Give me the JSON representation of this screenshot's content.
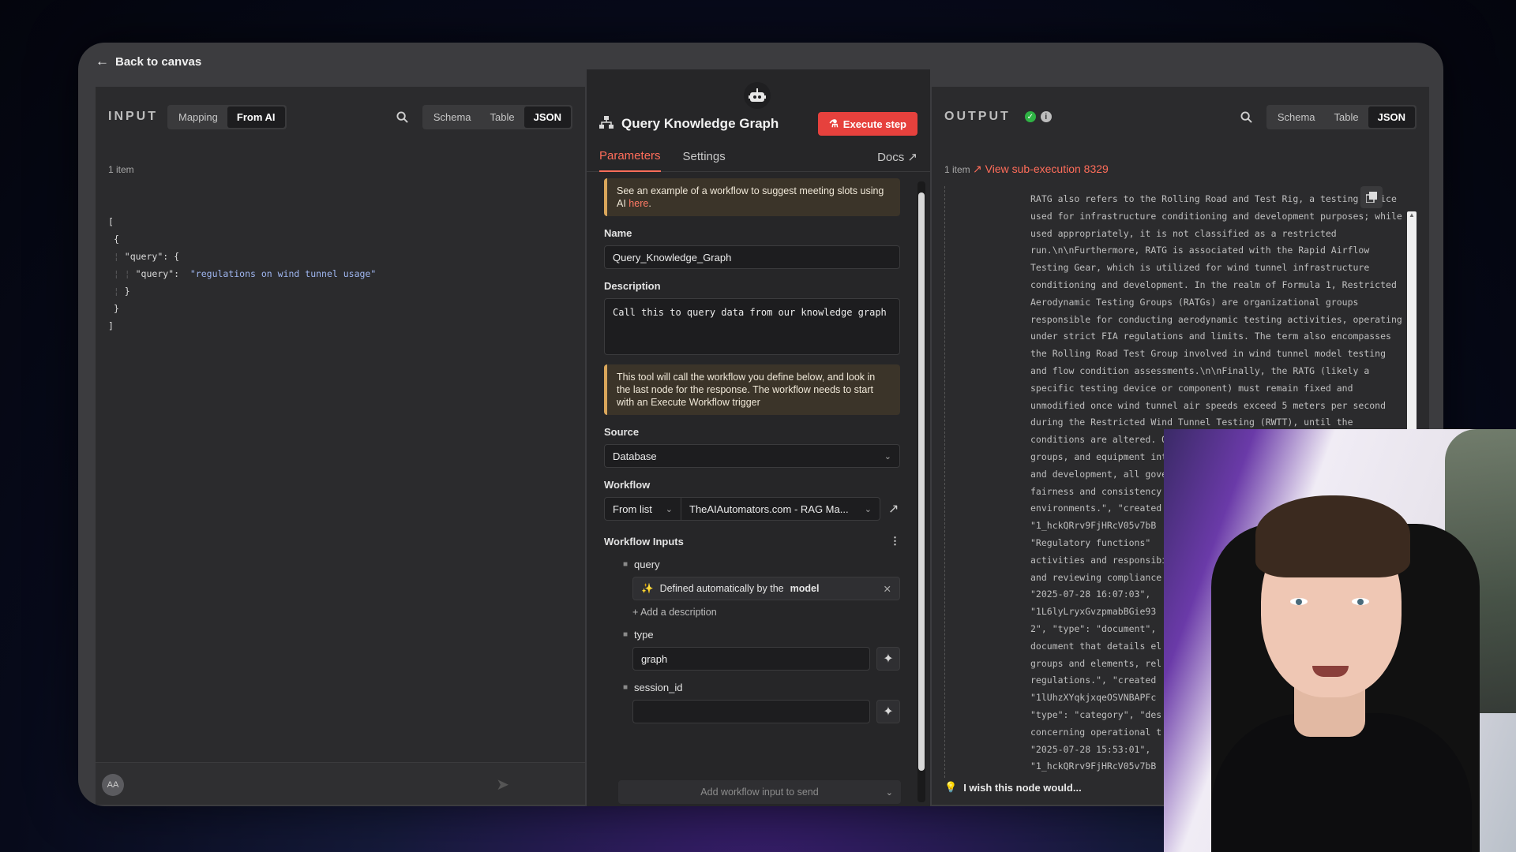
{
  "back_link": "Back to canvas",
  "input": {
    "title": "INPUT",
    "mode_tabs": [
      "Mapping",
      "From AI"
    ],
    "view_tabs": [
      "Schema",
      "Table",
      "JSON"
    ],
    "items": "1 item",
    "json_lines": [
      {
        "text": "[",
        "indent": ""
      },
      {
        "text": "{",
        "indent": " "
      },
      {
        "text": "\"query\": {",
        "indent": " ¦ "
      },
      {
        "text": "\"query\":  ",
        "value": "\"regulations on wind tunnel usage\"",
        "indent": " ¦ ¦ "
      },
      {
        "text": "}",
        "indent": " ¦ "
      },
      {
        "text": "}",
        "indent": " "
      },
      {
        "text": "]",
        "indent": ""
      }
    ],
    "avatar": "AA"
  },
  "node": {
    "title": "Query Knowledge Graph",
    "execute": "Execute step",
    "tabs": [
      "Parameters",
      "Settings"
    ],
    "docs": "Docs",
    "callout1_text": "See an example of a workflow to suggest meeting slots using AI ",
    "callout1_link": "here",
    "name_label": "Name",
    "name_value": "Query_Knowledge_Graph",
    "description_label": "Description",
    "description_value": "Call this to query data from our knowledge graph",
    "callout2": "This tool will call the workflow you define below, and look in the last node for the response. The workflow needs to start with an Execute Workflow trigger",
    "source_label": "Source",
    "source_value": "Database",
    "workflow_label": "Workflow",
    "workflow_from": "From list",
    "workflow_name": "TheAIAutomators.com - RAG Ma...",
    "workflow_inputs_label": "Workflow Inputs",
    "inputs": {
      "query_name": "query",
      "query_defined": "Defined automatically by the",
      "query_defined_bold": "model",
      "add_description": "+ Add a description",
      "type_name": "type",
      "type_value": "graph",
      "session_name": "session_id",
      "session_value": ""
    },
    "add_input": "Add workflow input to send"
  },
  "output": {
    "title": "OUTPUT",
    "view_tabs": [
      "Schema",
      "Table",
      "JSON"
    ],
    "items": "1 item",
    "subexec": "View sub-execution 8329",
    "lines": [
      "RATG also refers to the Rolling Road and Test Rig, a testing device",
      "used for infrastructure conditioning and development purposes; while",
      "used appropriately, it is not classified as a restricted",
      "run.\\n\\nFurthermore, RATG is associated with the Rapid Airflow",
      "Testing Gear, which is utilized for wind tunnel infrastructure",
      "conditioning and development. In the realm of Formula 1, Restricted",
      "Aerodynamic Testing Groups (RATGs) are organizational groups",
      "responsible for conducting aerodynamic testing activities, operating",
      "under strict FIA regulations and limits. The term also encompasses",
      "the Rolling Road Test Group involved in wind tunnel model testing",
      "and flow condition assessments.\\n\\nFinally, the RATG (likely a",
      "specific testing device or component) must remain fixed and",
      "unmodified once wind tunnel air speeds exceed 5 meters per second",
      "during the Restricted Wind Tunnel Testing (RWTT), until the",
      "conditions are altered. Overall, RATG encompasses various models,",
      "groups, and equipment integral",
      "and development, all gove",
      "fairness and consistency",
      "environments.\", \"created",
      "\"1_hckQRrv9FjHRcV05v7bB",
      "\"Regulatory functions\"",
      "activities and responsibi",
      "and reviewing compliance",
      "\"2025-07-28 16:07:03\",",
      "\"1L6lyLryxGvzpmabBGie93",
      "2\", \"type\": \"document\",",
      "document that details el",
      "groups and elements, rel",
      "regulations.\", \"created",
      "\"1lUhzXYqkjxqeOSVNBAPFc",
      "\"type\": \"category\", \"des",
      "concerning operational t",
      "\"2025-07-28 15:53:01\",",
      "\"1_hckQRrv9FjHRcV05v7bB"
    ],
    "feedback": "I wish this node would..."
  },
  "colors": {
    "accent": "#ff6d5a",
    "execute": "#e6413d",
    "success": "#2fb344",
    "callout_border": "#d9a65b"
  }
}
